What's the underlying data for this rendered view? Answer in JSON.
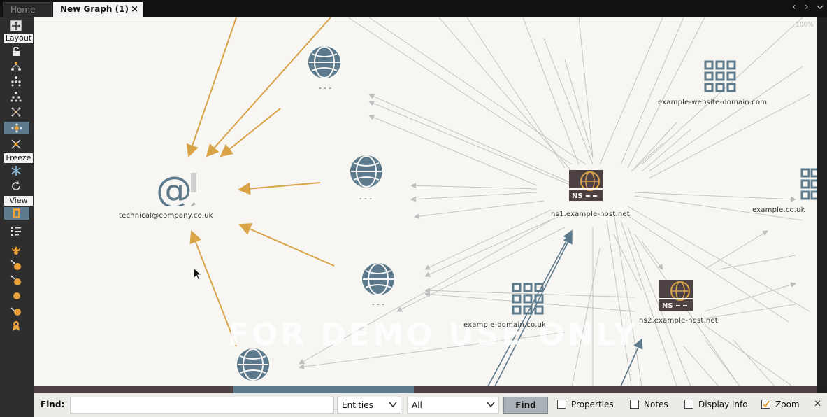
{
  "tabs": {
    "home": "Home",
    "active": "New Graph (1)",
    "close": "×"
  },
  "nav": {
    "prev": "‹",
    "next": "›"
  },
  "toolbar": {
    "layout_label": "Layout",
    "freeze_label": "Freeze",
    "view_label": "View"
  },
  "canvas": {
    "zoom": "100%",
    "watermark": "FOR DEMO USE ONLY",
    "nodes": {
      "email": {
        "icon": "email-at-icon",
        "label": "technical@company.co.uk"
      },
      "globe1": {
        "icon": "globe-icon",
        "label": "- - -"
      },
      "globe2": {
        "icon": "globe-icon",
        "label": "- - -"
      },
      "globe3": {
        "icon": "globe-icon",
        "label": "- - -"
      },
      "globe4": {
        "icon": "globe-icon",
        "label": ""
      },
      "ns1": {
        "icon": "nameserver-icon",
        "label": "ns1.example-host.net"
      },
      "ns2": {
        "icon": "nameserver-icon",
        "label": "ns2.example-host.net"
      },
      "domain1": {
        "icon": "domain-network-icon",
        "label": "example-website-domain.com"
      },
      "domain2": {
        "icon": "domain-network-icon",
        "label": "example-domain.co.uk"
      },
      "domain3": {
        "icon": "domain-network-icon",
        "label": "example.co.uk"
      }
    },
    "colors": {
      "accent_edge": "#d9a348",
      "grey_edge": "#bdbdbd",
      "blue_edge": "#5d7a8c",
      "node_blue": "#5d7a8c",
      "ns_dark": "#4e4143"
    }
  },
  "findbar": {
    "find_label": "Find:",
    "search_value": "",
    "type_select": "Entities",
    "scope_select": "All",
    "find_button": "Find",
    "properties": {
      "label": "Properties",
      "checked": false
    },
    "notes": {
      "label": "Notes",
      "checked": false
    },
    "display_info": {
      "label": "Display info",
      "checked": false
    },
    "zoom": {
      "label": "Zoom",
      "checked": true
    },
    "close": "✕"
  }
}
